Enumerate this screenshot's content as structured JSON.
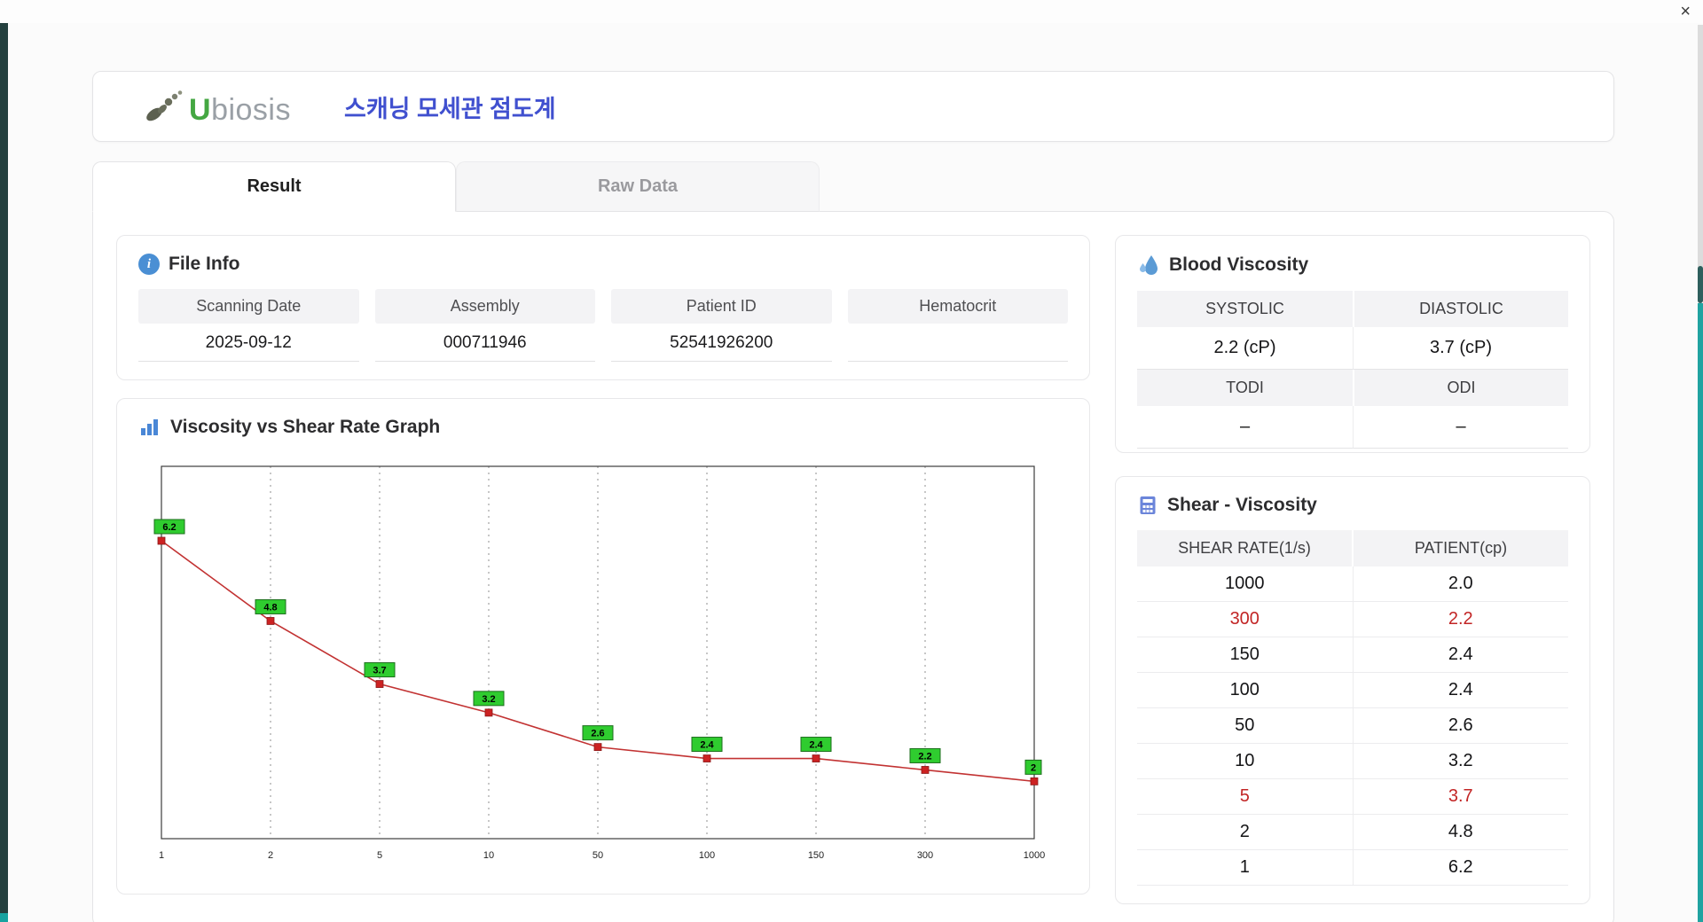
{
  "window": {
    "close": "×"
  },
  "icons": {
    "info": "i"
  },
  "header": {
    "logo_u": "U",
    "logo_rest": "biosis",
    "title": "스캐닝 모세관 점도계"
  },
  "tabs": {
    "result": "Result",
    "raw": "Raw Data"
  },
  "file_info": {
    "title": "File Info",
    "fields": [
      {
        "label": "Scanning Date",
        "value": "2025-09-12"
      },
      {
        "label": "Assembly",
        "value": "000711946"
      },
      {
        "label": "Patient ID",
        "value": "52541926200"
      },
      {
        "label": "Hematocrit",
        "value": ""
      }
    ]
  },
  "graph_section": {
    "title": "Viscosity vs Shear Rate Graph"
  },
  "chart_data": {
    "type": "line",
    "title": "Viscosity vs Shear Rate Graph",
    "categories": [
      "1",
      "2",
      "5",
      "10",
      "50",
      "100",
      "150",
      "300",
      "1000"
    ],
    "values": [
      6.2,
      4.8,
      3.7,
      3.2,
      2.6,
      2.4,
      2.4,
      2.2,
      2.0
    ],
    "point_labels": [
      "6.2",
      "4.8",
      "3.7",
      "3.2",
      "2.6",
      "2.4",
      "2.4",
      "2.2",
      "2"
    ],
    "xlabel": "",
    "ylabel": "",
    "ylim": [
      1,
      7.5
    ],
    "x_scale": "categorical",
    "grid": "vertical-dashed",
    "line_color": "#c23232",
    "marker_color": "#cc2222",
    "label_bg": "#2fcc2f",
    "label_border": "#1c6e1c",
    "legend": "none"
  },
  "blood_viscosity": {
    "title": "Blood Viscosity",
    "systolic": {
      "label": "SYSTOLIC",
      "value": "2.2 (cP)"
    },
    "diastolic": {
      "label": "DIASTOLIC",
      "value": "3.7 (cP)"
    },
    "todi": {
      "label": "TODI",
      "value": "–"
    },
    "odi": {
      "label": "ODI",
      "value": "–"
    }
  },
  "shear_viscosity": {
    "title": "Shear - Viscosity",
    "columns": [
      "SHEAR RATE(1/s)",
      "PATIENT(cp)"
    ],
    "rows": [
      {
        "rate": "1000",
        "patient": "2.0",
        "highlight": false
      },
      {
        "rate": "300",
        "patient": "2.2",
        "highlight": true
      },
      {
        "rate": "150",
        "patient": "2.4",
        "highlight": false
      },
      {
        "rate": "100",
        "patient": "2.4",
        "highlight": false
      },
      {
        "rate": "50",
        "patient": "2.6",
        "highlight": false
      },
      {
        "rate": "10",
        "patient": "3.2",
        "highlight": false
      },
      {
        "rate": "5",
        "patient": "3.7",
        "highlight": true
      },
      {
        "rate": "2",
        "patient": "4.8",
        "highlight": false
      },
      {
        "rate": "1",
        "patient": "6.2",
        "highlight": false
      }
    ]
  }
}
